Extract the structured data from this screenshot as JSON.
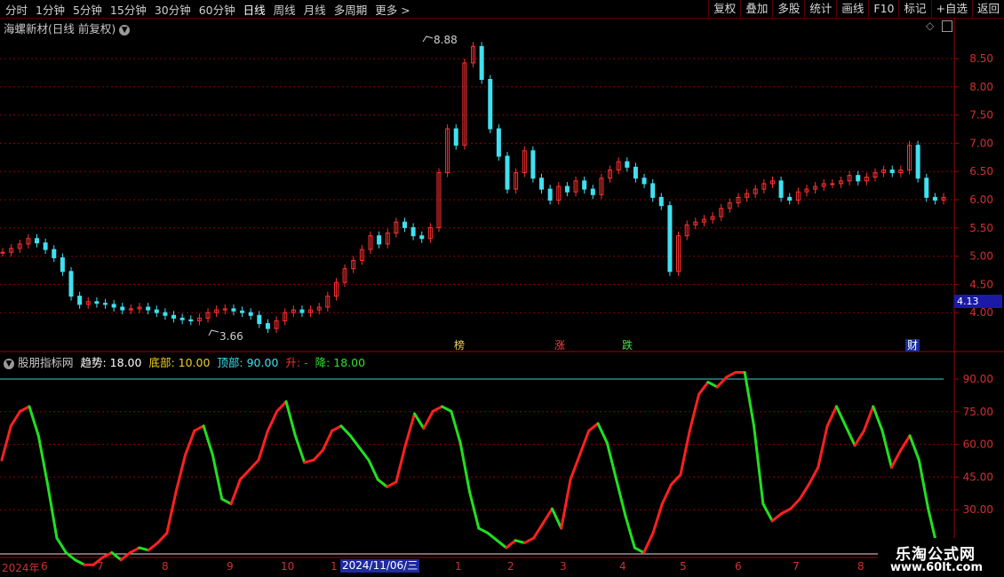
{
  "toolbar": {
    "periods": [
      "分时",
      "1分钟",
      "5分钟",
      "15分钟",
      "30分钟",
      "60分钟",
      "日线",
      "周线",
      "月线",
      "多周期",
      "更多 >"
    ],
    "active_period": "日线",
    "right_buttons": [
      "复权",
      "叠加",
      "多股",
      "统计",
      "画线",
      "F10",
      "标记",
      "+自选",
      "返回"
    ]
  },
  "main_panel": {
    "title": "海螺新材(日线 前复权)",
    "high_label": "8.88",
    "low_label": "3.66",
    "price_tag": "4.13",
    "y_ticks": [
      "8.50",
      "8.00",
      "7.50",
      "7.00",
      "6.50",
      "6.00",
      "5.50",
      "5.00",
      "4.50",
      "4.00"
    ],
    "markers": [
      {
        "text": "榜",
        "color": "#f0d060"
      },
      {
        "text": "涨",
        "color": "#ff4040"
      },
      {
        "text": "跌",
        "color": "#40e040"
      },
      {
        "text": "财",
        "color": "#ffffff",
        "bg": "#1a2aa0"
      }
    ]
  },
  "indicator_panel": {
    "name": "股朋指标网",
    "trend_label": "趋势: 18.00",
    "bottom_label": "底部: 10.00",
    "top_label": "顶部: 90.00",
    "up_label": "升: -",
    "down_label": "降: 18.00",
    "y_ticks": [
      "90.00",
      "75.00",
      "60.00",
      "45.00",
      "30.00"
    ]
  },
  "x_axis": {
    "labels": [
      "2024年",
      "6",
      "7",
      "8",
      "9",
      "10",
      "1",
      "1",
      "2",
      "3",
      "4",
      "5",
      "6",
      "7",
      "8"
    ],
    "highlight_date": "2024/11/06/三"
  },
  "watermark": {
    "line1": "乐淘公式网",
    "line2": "www.60lt.com"
  },
  "colors": {
    "up": "#ff3030",
    "down": "#40e0f0",
    "ind_up": "#ff2020",
    "ind_down": "#20e020",
    "grid": "#8b0000"
  },
  "chart_data": {
    "type": "line",
    "price_range": [
      3.5,
      9.0
    ],
    "indicator_range": [
      18,
      96
    ],
    "close_points": [
      5.05,
      5.12,
      5.2,
      5.3,
      5.22,
      5.1,
      4.95,
      4.7,
      4.25,
      4.1,
      4.15,
      4.12,
      4.1,
      4.05,
      4.0,
      4.02,
      4.05,
      4.0,
      3.95,
      3.9,
      3.85,
      3.82,
      3.8,
      3.85,
      3.95,
      4.0,
      4.02,
      3.98,
      3.95,
      3.9,
      3.75,
      3.66,
      3.8,
      3.95,
      4.0,
      3.95,
      4.0,
      4.05,
      4.25,
      4.5,
      4.75,
      4.9,
      5.1,
      5.35,
      5.2,
      5.4,
      5.6,
      5.5,
      5.35,
      5.3,
      5.5,
      6.5,
      7.3,
      7.0,
      8.5,
      8.8,
      8.2,
      7.3,
      6.8,
      6.2,
      6.5,
      6.9,
      6.4,
      6.2,
      6.0,
      6.25,
      6.15,
      6.35,
      6.2,
      6.1,
      6.4,
      6.55,
      6.7,
      6.6,
      6.4,
      6.3,
      6.05,
      5.9,
      4.7,
      5.35,
      5.55,
      5.6,
      5.65,
      5.7,
      5.85,
      5.95,
      6.05,
      6.12,
      6.2,
      6.3,
      6.35,
      6.05,
      6.0,
      6.15,
      6.2,
      6.25,
      6.3,
      6.3,
      6.35,
      6.45,
      6.35,
      6.42,
      6.5,
      6.55,
      6.5,
      6.55,
      7.0,
      6.4,
      6.05,
      6.0,
      6.05
    ],
    "indicator_points": [
      58,
      72,
      78,
      80,
      68,
      48,
      26,
      20,
      17,
      15,
      15,
      18,
      20,
      17,
      20,
      22,
      21,
      24,
      28,
      45,
      60,
      70,
      72,
      60,
      42,
      40,
      50,
      54,
      58,
      70,
      78,
      82,
      68,
      57,
      58,
      62,
      70,
      72,
      68,
      63,
      58,
      50,
      47,
      49,
      64,
      77,
      71,
      78,
      80,
      78,
      65,
      45,
      30,
      28,
      25,
      22,
      25,
      24,
      26,
      32,
      38,
      30,
      50,
      60,
      70,
      73,
      65,
      50,
      35,
      22,
      20,
      28,
      40,
      48,
      52,
      70,
      85,
      90,
      88,
      92,
      94,
      94,
      72,
      40,
      33,
      36,
      38,
      42,
      48,
      55,
      72,
      80,
      72,
      64,
      70,
      80,
      70,
      55,
      62,
      68,
      58,
      38,
      22
    ]
  }
}
